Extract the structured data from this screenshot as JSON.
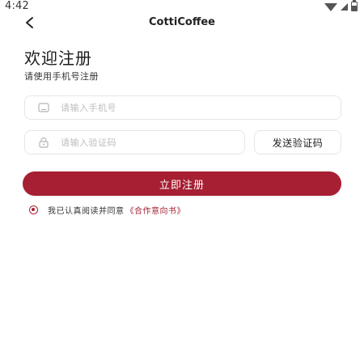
{
  "status_bar": {
    "time": "4:42",
    "icons": [
      "wifi-icon",
      "signal-icon",
      "battery-icon"
    ]
  },
  "header": {
    "back_icon": "back-arrow-icon",
    "title": "CottiCoffee"
  },
  "page": {
    "title": "欢迎注册",
    "subtitle": "请使用手机号注册"
  },
  "form": {
    "phone": {
      "icon": "phone-icon",
      "placeholder": "请输入手机号",
      "value": ""
    },
    "code": {
      "icon": "lock-icon",
      "placeholder": "请输入验证码",
      "value": ""
    },
    "send_code_label": "发送验证码",
    "register_label": "立即注册"
  },
  "agreement": {
    "checked": true,
    "text": "我已认真阅读并同意",
    "link_text": "《合作意向书》"
  },
  "colors": {
    "accent": "#a61f33",
    "border": "#e6e6e6",
    "placeholder": "#bdbdbd"
  }
}
